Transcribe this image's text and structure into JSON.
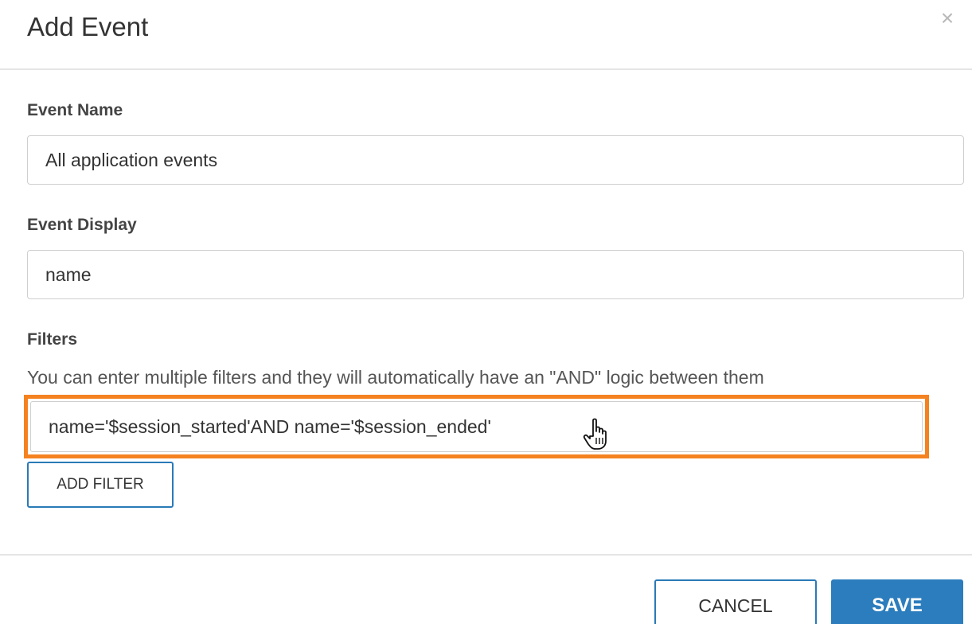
{
  "dialog": {
    "title": "Add Event",
    "close_glyph": "×"
  },
  "event_name": {
    "label": "Event Name",
    "value": "All application events"
  },
  "event_display": {
    "label": "Event Display",
    "value": "name"
  },
  "filters": {
    "label": "Filters",
    "help_text": "You can enter multiple filters and they will automatically have an \"AND\" logic between them",
    "value": "name='$session_started'AND name='$session_ended'",
    "highlight_color": "#f58220",
    "add_filter_label": "ADD FILTER"
  },
  "footer": {
    "cancel_label": "CANCEL",
    "save_label": "SAVE"
  },
  "colors": {
    "primary": "#2c7dbd",
    "highlight": "#f58220"
  },
  "icons": {
    "close": "close-icon",
    "cursor": "hand-pointer-icon"
  }
}
